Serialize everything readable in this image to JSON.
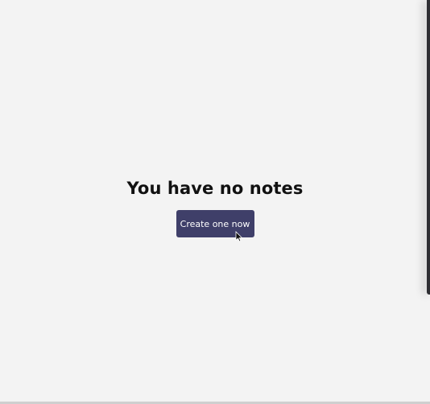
{
  "empty_state": {
    "heading": "You have no notes",
    "button_label": "Create one now"
  },
  "icons": {
    "cursor": "mouse-pointer-icon"
  },
  "colors": {
    "background": "#f3f3f3",
    "button": "#3f3f69",
    "heading": "#111111"
  }
}
